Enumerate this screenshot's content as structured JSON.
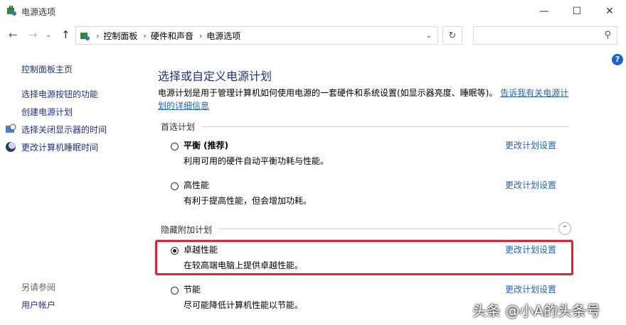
{
  "window": {
    "title": "电源选项"
  },
  "address": {
    "crumbs": [
      "控制面板",
      "硬件和声音",
      "电源选项"
    ]
  },
  "search": {
    "placeholder": ""
  },
  "sidebar": {
    "home": "控制面板主页",
    "links": [
      "选择电源按钮的功能",
      "创建电源计划",
      "选择关闭显示器的时间",
      "更改计算机睡眠时间"
    ],
    "see_also_label": "另请参阅",
    "see_also_links": [
      "用户帐户"
    ]
  },
  "main": {
    "heading": "选择或自定义电源计划",
    "description": "电源计划是用于管理计算机如何使用电源的一套硬件和系统设置(如显示器亮度、睡眠等)。",
    "description_link": "告诉我有关电源计划的详细信息",
    "preferred_label": "首选计划",
    "hidden_label": "隐藏附加计划",
    "change_label": "更改计划设置",
    "plans": [
      {
        "name": "平衡 (推荐)",
        "desc": "利用可用的硬件自动平衡功耗与性能。",
        "selected": false
      },
      {
        "name": "高性能",
        "desc": "有利于提高性能，但会增加功耗。",
        "selected": false
      },
      {
        "name": "卓越性能",
        "desc": "在较高端电脑上提供卓越性能。",
        "selected": true
      },
      {
        "name": "节能",
        "desc": "尽可能降低计算机性能以节能。",
        "selected": false
      }
    ]
  },
  "watermark": "头条 @小A的头条号",
  "colors": {
    "link": "#1e3287",
    "highlight": "#e0232f",
    "help": "#1a63c9"
  }
}
